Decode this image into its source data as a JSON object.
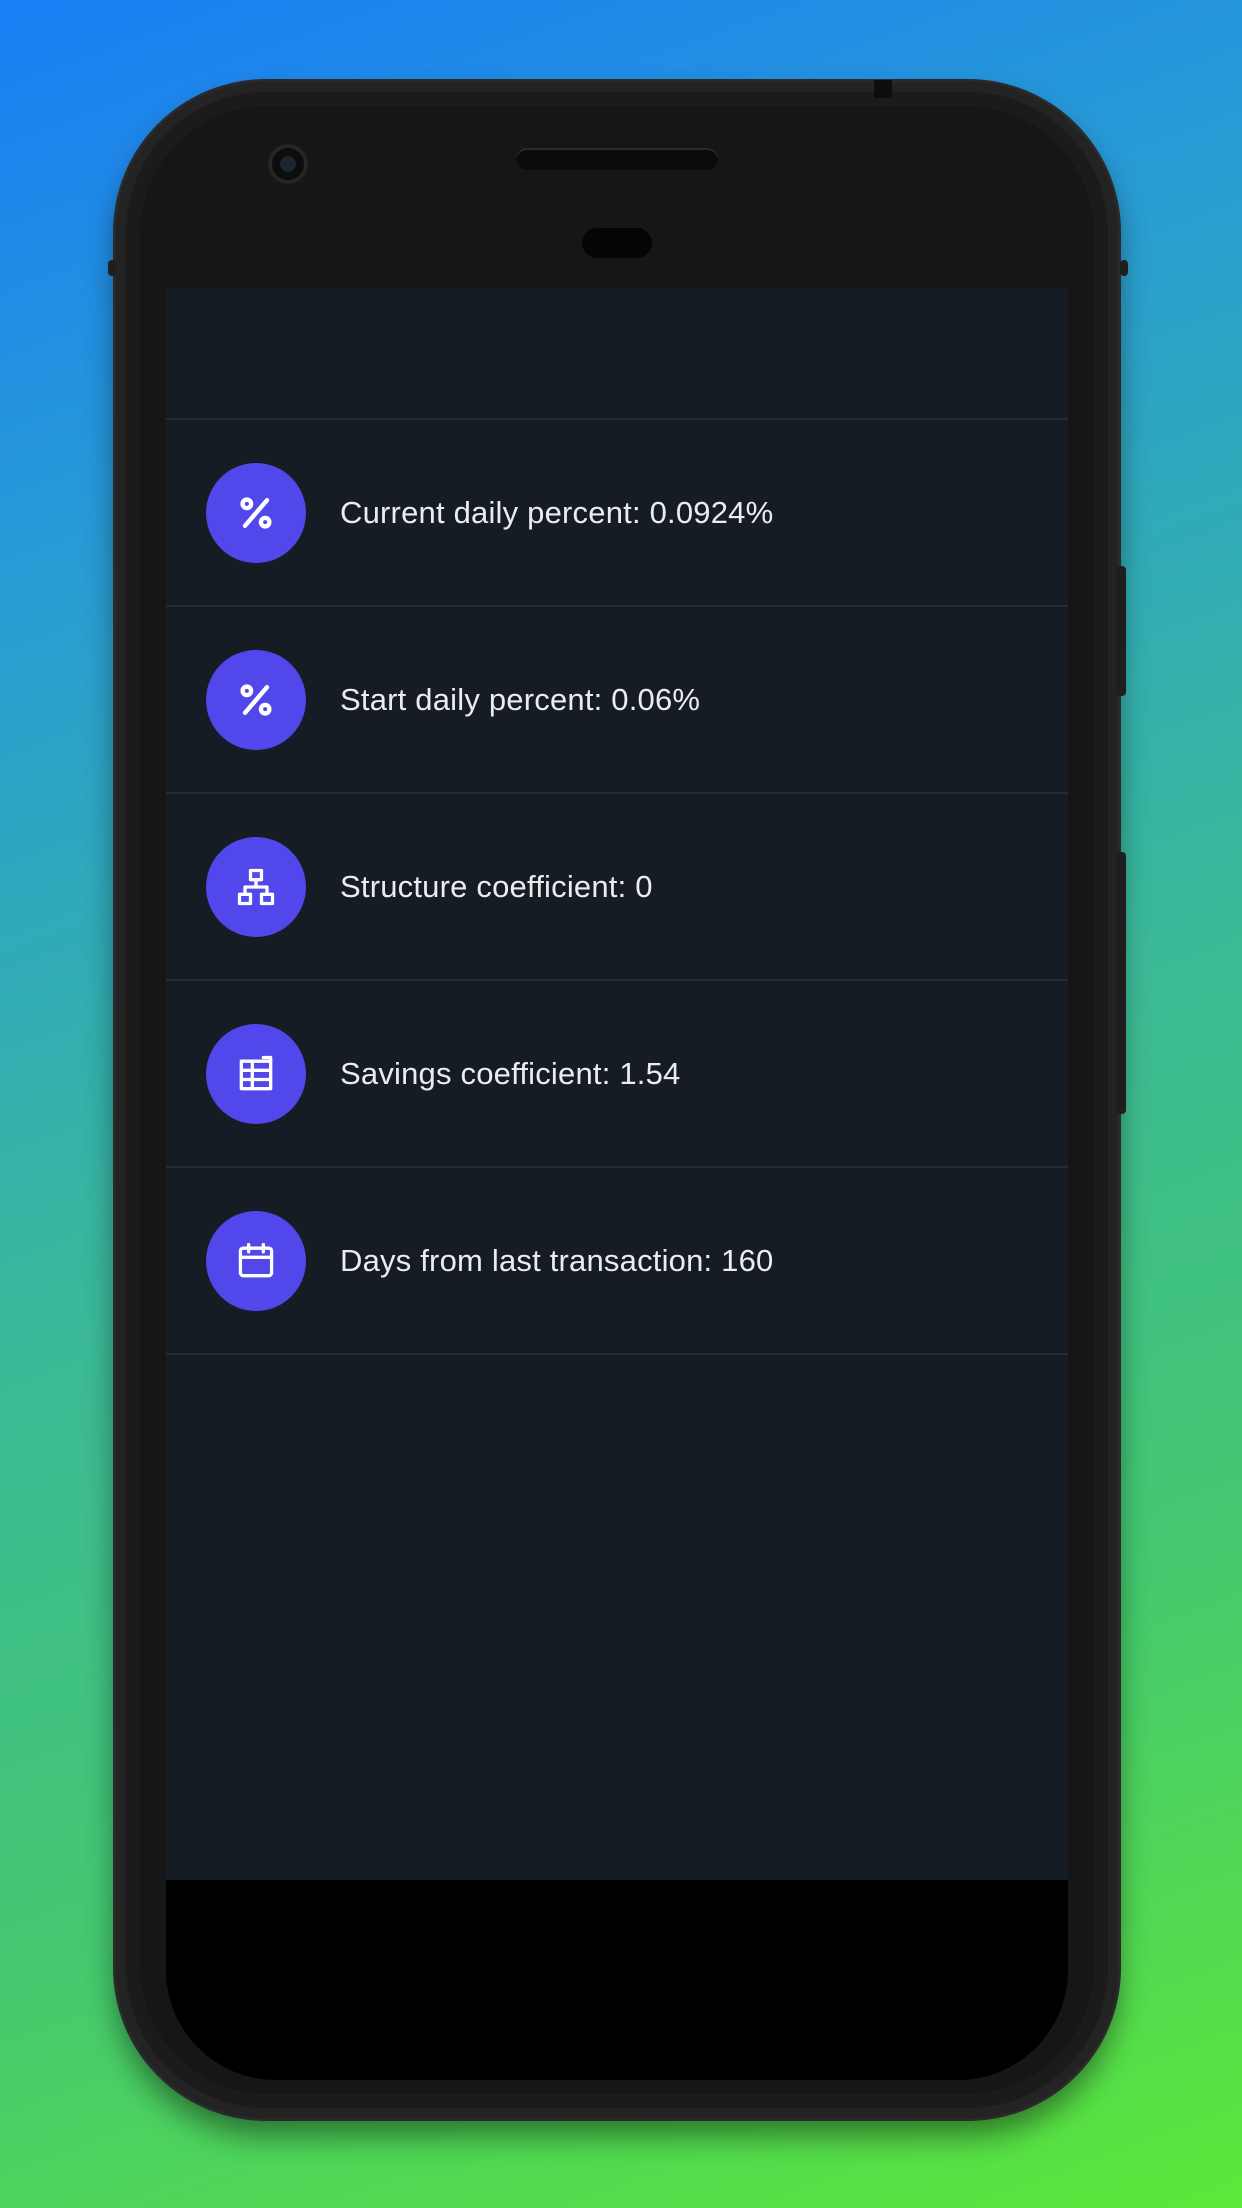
{
  "stats": {
    "items": [
      {
        "icon": "percent-icon",
        "label": "Current daily percent: 0.0924%"
      },
      {
        "icon": "percent-icon",
        "label": "Start daily percent: 0.06%"
      },
      {
        "icon": "structure-icon",
        "label": "Structure coefficient: 0"
      },
      {
        "icon": "savings-icon",
        "label": "Savings coefficient: 1.54"
      },
      {
        "icon": "calendar-icon",
        "label": "Days from last transaction: 160"
      }
    ]
  },
  "colors": {
    "background_gradient_start": "#1a7ef5",
    "background_gradient_end": "#5de83a",
    "screen_background": "#161c24",
    "icon_circle": "#5147ea",
    "text": "#ececef",
    "divider": "#252c35"
  }
}
